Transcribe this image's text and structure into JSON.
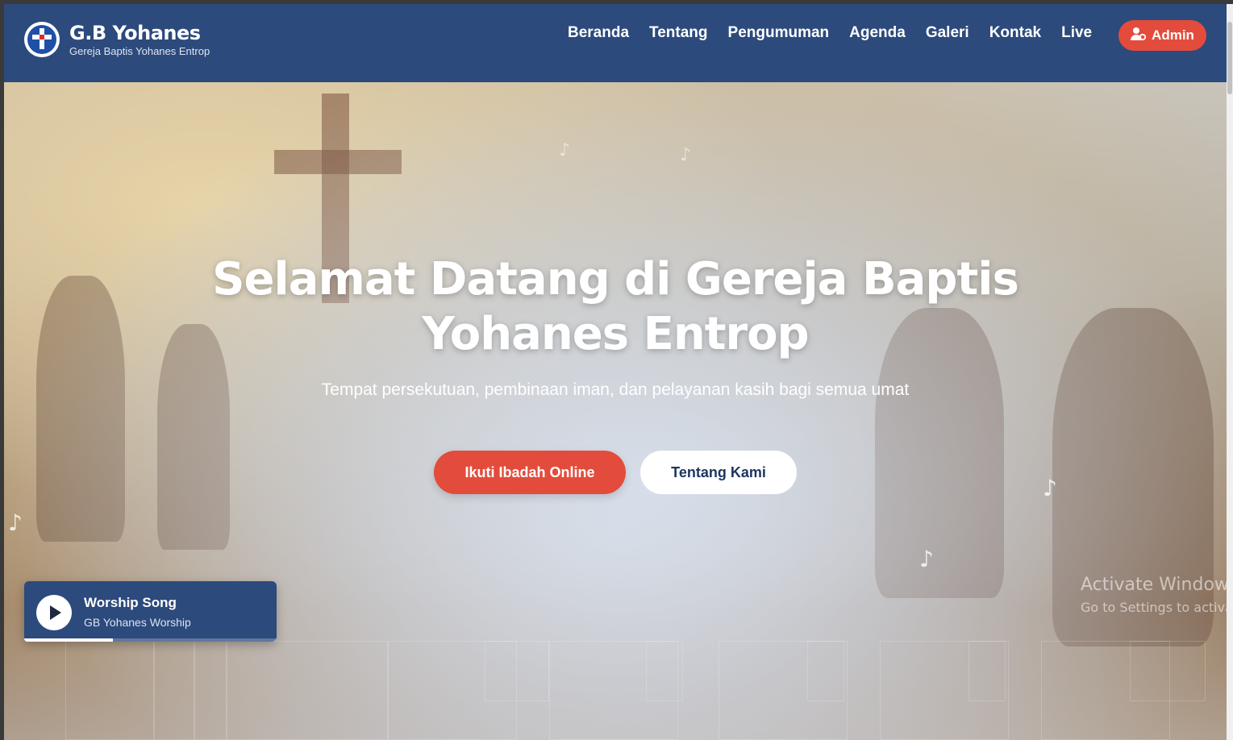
{
  "brand": {
    "name": "G.B Yohanes",
    "subtitle": "Gereja Baptis Yohanes Entrop"
  },
  "nav": {
    "items": [
      {
        "label": "Beranda"
      },
      {
        "label": "Tentang"
      },
      {
        "label": "Pengumuman"
      },
      {
        "label": "Agenda"
      },
      {
        "label": "Galeri"
      },
      {
        "label": "Kontak"
      },
      {
        "label": "Live"
      }
    ],
    "admin_label": "Admin"
  },
  "hero": {
    "title": "Selamat Datang di Gereja Baptis Yohanes Entrop",
    "subtitle": "Tempat persekutuan, pembinaan iman, dan pelayanan kasih bagi semua umat",
    "primary_button": "Ikuti Ibadah Online",
    "secondary_button": "Tentang Kami"
  },
  "player": {
    "title": "Worship Song",
    "artist": "GB Yohanes Worship",
    "progress": 0.35
  },
  "watermark": {
    "line1": "Activate Windows",
    "line2": "Go to Settings to activate Windows."
  },
  "colors": {
    "header": "#2c4a7c",
    "accent": "#e34c3c"
  }
}
